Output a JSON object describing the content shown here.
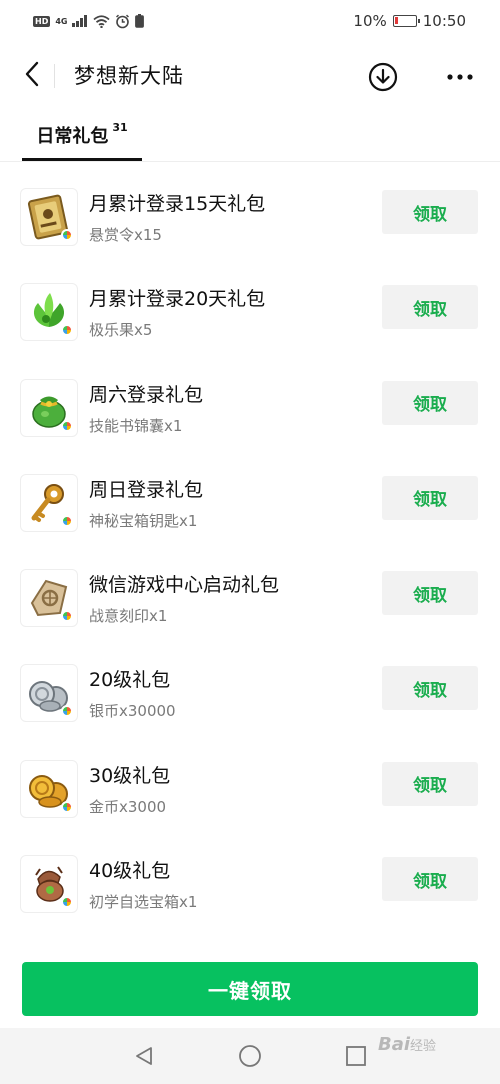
{
  "status_bar": {
    "hd": "HD",
    "network": "4G",
    "battery_percent": "10%",
    "time": "10:50",
    "battery_color": "#e03a3a"
  },
  "nav": {
    "title": "梦想新大陆",
    "back_icon": "chevron-left-icon",
    "download_icon": "download-circle-icon",
    "more_icon": "more-dots-icon"
  },
  "tabs": [
    {
      "label": "日常礼包",
      "count": "31",
      "active": true
    }
  ],
  "items": [
    {
      "title": "月累计登录15天礼包",
      "reward": "悬赏令x15",
      "button": "领取",
      "icon": "bounty-scroll-icon"
    },
    {
      "title": "月累计登录20天礼包",
      "reward": "极乐果x5",
      "button": "领取",
      "icon": "bliss-fruit-icon"
    },
    {
      "title": "周六登录礼包",
      "reward": "技能书锦囊x1",
      "button": "领取",
      "icon": "skill-book-bag-icon"
    },
    {
      "title": "周日登录礼包",
      "reward": "神秘宝箱钥匙x1",
      "button": "领取",
      "icon": "mystery-key-icon"
    },
    {
      "title": "微信游戏中心启动礼包",
      "reward": "战意刻印x1",
      "button": "领取",
      "icon": "battle-seal-icon"
    },
    {
      "title": "20级礼包",
      "reward": "银币x30000",
      "button": "领取",
      "icon": "silver-coins-icon"
    },
    {
      "title": "30级礼包",
      "reward": "金币x3000",
      "button": "领取",
      "icon": "gold-coins-icon"
    },
    {
      "title": "40级礼包",
      "reward": "初学自选宝箱x1",
      "button": "领取",
      "icon": "beginner-chest-icon"
    }
  ],
  "claim_all_label": "一键领取",
  "colors": {
    "accent_green": "#07c160",
    "claim_text_green": "#1aad4e",
    "claim_button_bg": "#f2f2f2"
  },
  "system_nav": {
    "back_icon": "triangle-back-icon",
    "home_icon": "circle-home-icon",
    "recents_icon": "square-recents-icon"
  },
  "watermark": {
    "brand": "Bai",
    "suffix": "经验"
  }
}
